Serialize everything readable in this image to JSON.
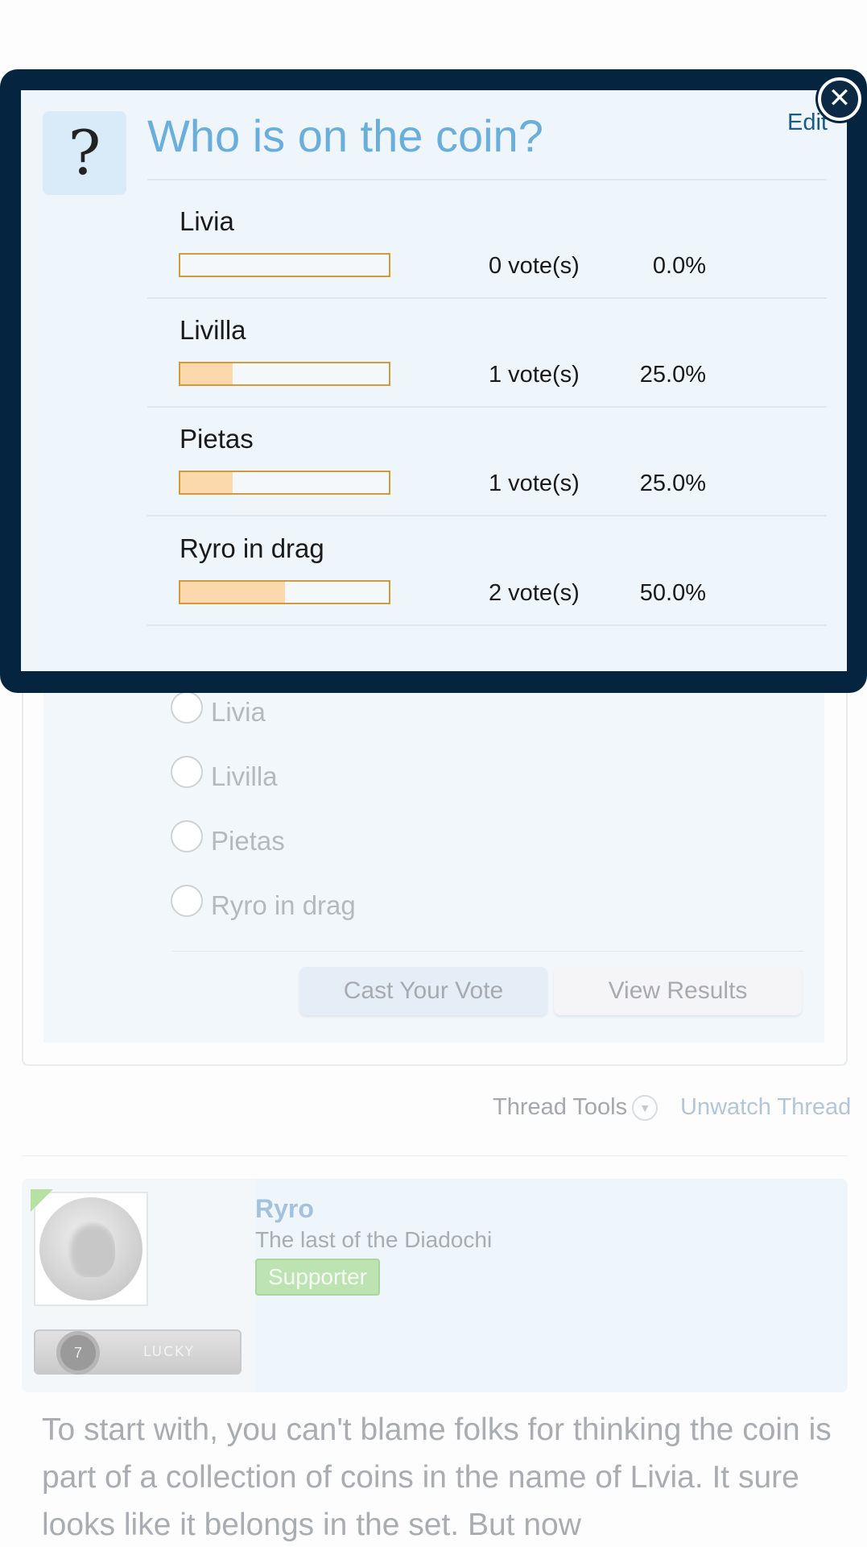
{
  "poll": {
    "question": "Who is on the coin?",
    "question_icon": "?",
    "edit_label": "Edit",
    "close_icon": "close-icon",
    "results": [
      {
        "label": "Livia",
        "votes_text": "0 vote(s)",
        "percent_text": "0.0%",
        "percent": 0
      },
      {
        "label": "Livilla",
        "votes_text": "1 vote(s)",
        "percent_text": "25.0%",
        "percent": 25
      },
      {
        "label": "Pietas",
        "votes_text": "1 vote(s)",
        "percent_text": "25.0%",
        "percent": 25
      },
      {
        "label": "Ryro in drag",
        "votes_text": "2 vote(s)",
        "percent_text": "50.0%",
        "percent": 50
      }
    ],
    "options": [
      "Livia",
      "Livilla",
      "Pietas",
      "Ryro in drag"
    ],
    "cast_vote_label": "Cast Your Vote",
    "view_results_label": "View Results"
  },
  "thread": {
    "tools_label": "Thread Tools",
    "unwatch_label": "Unwatch Thread"
  },
  "post": {
    "username": "Ryro",
    "user_title": "The last of the Diadochi",
    "badge": "Supporter",
    "rank_number": "7",
    "rank_label": "LUCKY",
    "body": "To start with, you can't blame folks for thinking the coin is part of a collection of coins in the name of Livia. It sure looks like it belongs in the set. But now"
  },
  "colors": {
    "modal_frame": "#04243f",
    "question_title": "#6aaedc",
    "bar_fill": "#fcd8ad",
    "bar_border": "#d19a3c"
  }
}
